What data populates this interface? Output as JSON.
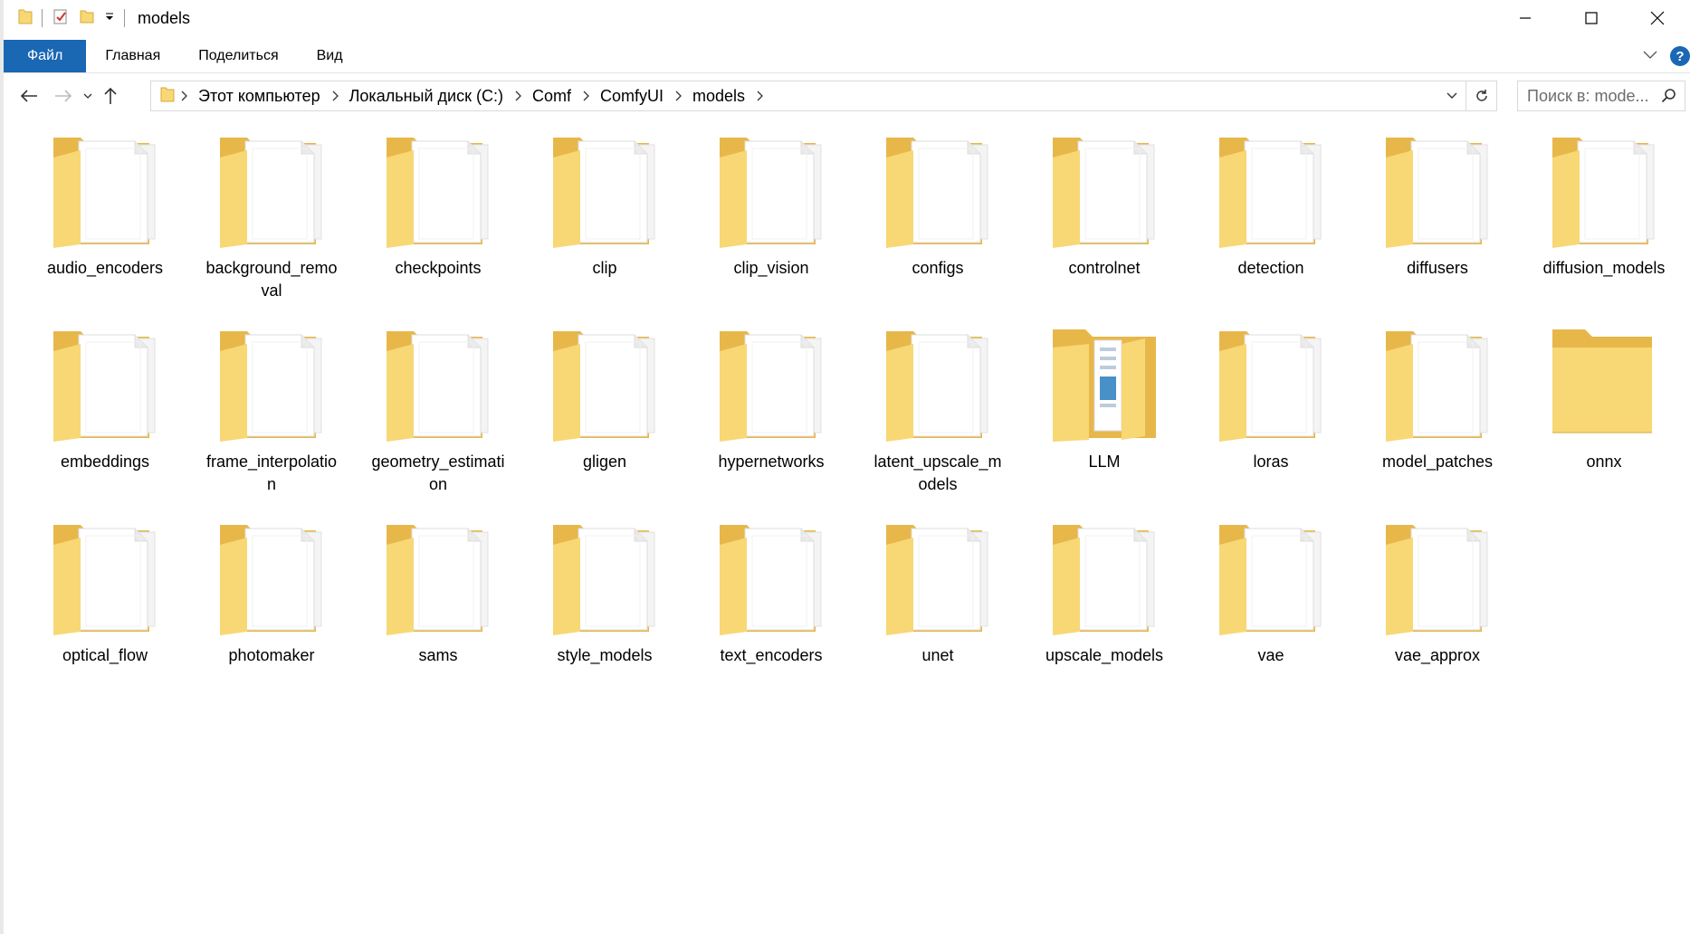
{
  "window": {
    "title": "models",
    "controls": {
      "minimize": "minimize",
      "maximize": "maximize",
      "close": "close"
    }
  },
  "ribbon": {
    "tabs": [
      {
        "label": "Файл",
        "active": true
      },
      {
        "label": "Главная"
      },
      {
        "label": "Поделиться"
      },
      {
        "label": "Вид"
      }
    ],
    "help_label": "?"
  },
  "address_bar": {
    "breadcrumbs": [
      "Этот компьютер",
      "Локальный диск (C:)",
      "Comf",
      "ComfyUI",
      "models"
    ]
  },
  "search": {
    "placeholder": "Поиск в: mode..."
  },
  "colors": {
    "accent": "#1a67b4",
    "folder": "#f8d775",
    "folder_dark": "#e8b74a",
    "paper": "#ffffff"
  },
  "folders": [
    {
      "name": "audio_encoders",
      "icon": "folder-docs"
    },
    {
      "name": "background_removal",
      "icon": "folder-docs"
    },
    {
      "name": "checkpoints",
      "icon": "folder-docs"
    },
    {
      "name": "clip",
      "icon": "folder-docs"
    },
    {
      "name": "clip_vision",
      "icon": "folder-docs"
    },
    {
      "name": "configs",
      "icon": "folder-docs"
    },
    {
      "name": "controlnet",
      "icon": "folder-docs"
    },
    {
      "name": "detection",
      "icon": "folder-docs"
    },
    {
      "name": "diffusers",
      "icon": "folder-docs"
    },
    {
      "name": "diffusion_models",
      "icon": "folder-docs"
    },
    {
      "name": "embeddings",
      "icon": "folder-docs"
    },
    {
      "name": "frame_interpolation",
      "icon": "folder-docs"
    },
    {
      "name": "geometry_estimation",
      "icon": "folder-docs"
    },
    {
      "name": "gligen",
      "icon": "folder-docs"
    },
    {
      "name": "hypernetworks",
      "icon": "folder-docs"
    },
    {
      "name": "latent_upscale_models",
      "icon": "folder-docs"
    },
    {
      "name": "LLM",
      "icon": "folder-open-image"
    },
    {
      "name": "loras",
      "icon": "folder-docs"
    },
    {
      "name": "model_patches",
      "icon": "folder-docs"
    },
    {
      "name": "onnx",
      "icon": "folder-empty"
    },
    {
      "name": "optical_flow",
      "icon": "folder-docs"
    },
    {
      "name": "photomaker",
      "icon": "folder-docs"
    },
    {
      "name": "sams",
      "icon": "folder-docs"
    },
    {
      "name": "style_models",
      "icon": "folder-docs"
    },
    {
      "name": "text_encoders",
      "icon": "folder-docs"
    },
    {
      "name": "unet",
      "icon": "folder-docs"
    },
    {
      "name": "upscale_models",
      "icon": "folder-docs"
    },
    {
      "name": "vae",
      "icon": "folder-docs"
    },
    {
      "name": "vae_approx",
      "icon": "folder-docs"
    }
  ]
}
